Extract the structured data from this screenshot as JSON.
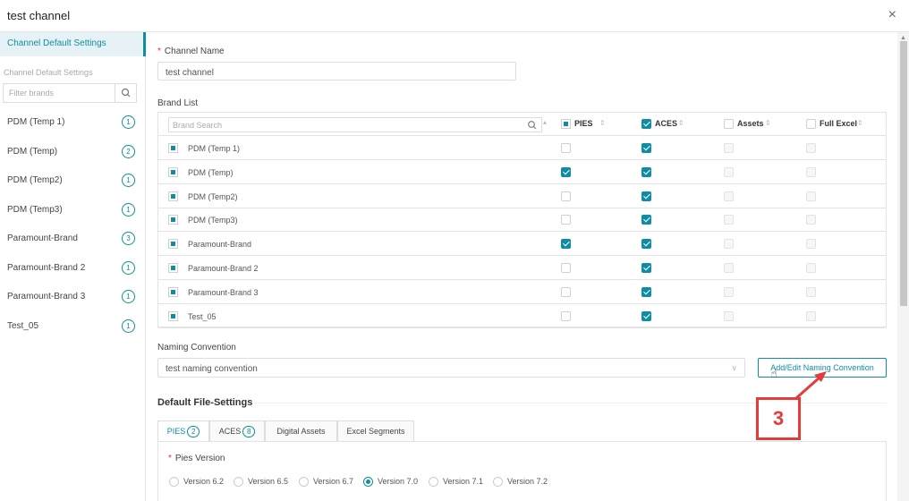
{
  "window": {
    "title": "test channel",
    "close": "×"
  },
  "sidebar": {
    "active_label": "Channel Default Settings",
    "section_label": "Channel Default Settings",
    "filter_placeholder": "Filter brands",
    "items": [
      {
        "label": "PDM (Temp 1)",
        "badge": "1"
      },
      {
        "label": "PDM (Temp)",
        "badge": "2"
      },
      {
        "label": "PDM (Temp2)",
        "badge": "1"
      },
      {
        "label": "PDM (Temp3)",
        "badge": "1"
      },
      {
        "label": "Paramount-Brand",
        "badge": "3"
      },
      {
        "label": "Paramount-Brand 2",
        "badge": "1"
      },
      {
        "label": "Paramount-Brand 3",
        "badge": "1"
      },
      {
        "label": "Test_05",
        "badge": "1"
      }
    ]
  },
  "form": {
    "required_mark": "*",
    "channel_name_label": "Channel Name",
    "channel_name_value": "test channel",
    "brand_list_label": "Brand List",
    "brand_search_placeholder": "Brand Search",
    "columns": [
      {
        "label": "PIES",
        "header_checked": "partial"
      },
      {
        "label": "ACES",
        "header_checked": "on"
      },
      {
        "label": "Assets",
        "header_checked": "off"
      },
      {
        "label": "Full Excel",
        "header_checked": "off"
      }
    ],
    "brands": [
      {
        "name": "PDM (Temp 1)",
        "pies": false,
        "aces": true,
        "assets": false,
        "excel": false
      },
      {
        "name": "PDM (Temp)",
        "pies": true,
        "aces": true,
        "assets": false,
        "excel": false
      },
      {
        "name": "PDM (Temp2)",
        "pies": false,
        "aces": true,
        "assets": false,
        "excel": false
      },
      {
        "name": "PDM (Temp3)",
        "pies": false,
        "aces": true,
        "assets": false,
        "excel": false
      },
      {
        "name": "Paramount-Brand",
        "pies": true,
        "aces": true,
        "assets": false,
        "excel": false
      },
      {
        "name": "Paramount-Brand 2",
        "pies": false,
        "aces": true,
        "assets": false,
        "excel": false
      },
      {
        "name": "Paramount-Brand 3",
        "pies": false,
        "aces": true,
        "assets": false,
        "excel": false
      },
      {
        "name": "Test_05",
        "pies": false,
        "aces": true,
        "assets": false,
        "excel": false
      }
    ],
    "naming_convention_label": "Naming Convention",
    "naming_convention_value": "test naming convention",
    "naming_button": "Add/Edit Naming Convention",
    "default_file_settings_title": "Default File-Settings",
    "tabs": [
      {
        "label": "PIES",
        "badge": "2"
      },
      {
        "label": "ACES",
        "badge": "8"
      },
      {
        "label": "Digital Assets",
        "badge": ""
      },
      {
        "label": "Excel Segments",
        "badge": ""
      }
    ],
    "pies_version_label": "Pies Version",
    "versions": [
      "Version 6.2",
      "Version 6.5",
      "Version 6.7",
      "Version 7.0",
      "Version 7.1",
      "Version 7.2"
    ],
    "selected_version": "Version 7.0"
  },
  "annotation": {
    "step": "3",
    "color": "#e63b3b"
  },
  "accent_color": "#0f8da3"
}
